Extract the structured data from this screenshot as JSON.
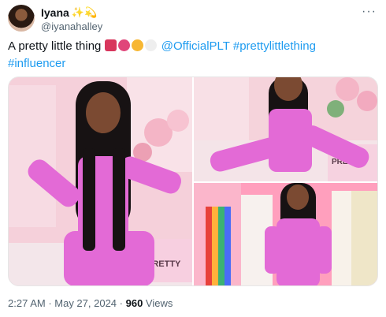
{
  "author": {
    "display_name": "Iyana",
    "handle": "@iyanahalley",
    "name_emoji": "✨💫"
  },
  "more_label": "···",
  "tweet": {
    "text": "A pretty little thing",
    "mention": "@OfficialPLT",
    "hashtag1": "#prettylittlething",
    "hashtag2": "#influencer",
    "emoji_icons": [
      "shopping-bags-icon",
      "ribbon-icon",
      "smiling-face-with-hearts-icon",
      "white-heart-icon"
    ]
  },
  "media": {
    "images": [
      {
        "icon": "photo-woman-seated-pink-outfit"
      },
      {
        "icon": "photo-woman-closeup-pink-outfit"
      },
      {
        "icon": "photo-woman-standing-pink-closet"
      }
    ],
    "sign_text": "PRETTY",
    "sign_text_2": "PRETT"
  },
  "footer": {
    "time": "2:27 AM",
    "sep1": " · ",
    "date": "May 27, 2024",
    "sep2": " · ",
    "views_count": "960",
    "views_label": " Views"
  },
  "colors": {
    "link": "#1d9bf0",
    "text": "#0f1419",
    "muted": "#536471",
    "outfit": "#e36ad6"
  }
}
